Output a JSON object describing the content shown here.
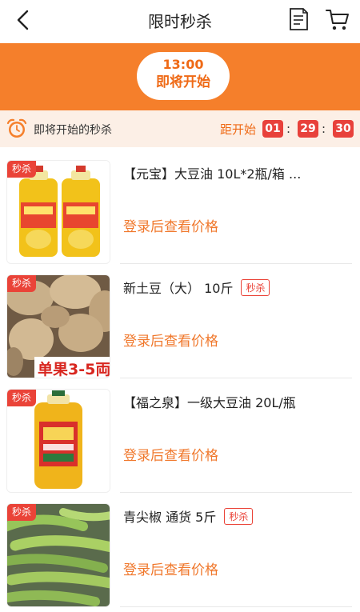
{
  "header": {
    "title": "限时秒杀"
  },
  "banner": {
    "time": "13:00",
    "status": "即将开始"
  },
  "status_bar": {
    "text": "即将开始的秒杀",
    "countdown_label": "距开始",
    "hours": "01",
    "minutes": "29",
    "seconds": "30",
    "separator": ":"
  },
  "products": [
    {
      "tag": "秒杀",
      "name": "【元宝】大豆油  10L*2瓶/箱 ...",
      "badge": "",
      "price_text": "登录后查看价格",
      "image_text": ""
    },
    {
      "tag": "秒杀",
      "name": "新土豆（大） 10斤",
      "badge": "秒杀",
      "price_text": "登录后查看价格",
      "image_text": "单果3-5両"
    },
    {
      "tag": "秒杀",
      "name": "【福之泉】一级大豆油 20L/瓶",
      "badge": "",
      "price_text": "登录后查看价格",
      "image_text": ""
    },
    {
      "tag": "秒杀",
      "name": "青尖椒 通货 5斤",
      "badge": "秒杀",
      "price_text": "登录后查看价格",
      "image_text": ""
    }
  ],
  "colors": {
    "accent": "#f57f2b",
    "tag_red": "#ea4338",
    "price_orange": "#f0782c"
  }
}
